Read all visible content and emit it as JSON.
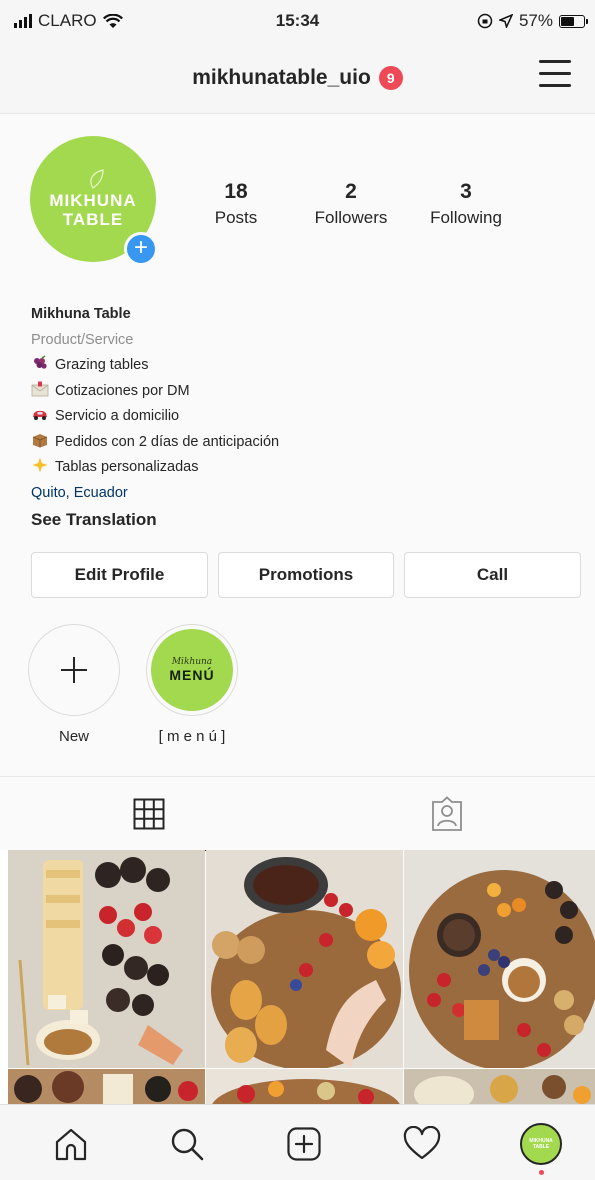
{
  "status_bar": {
    "carrier": "CLARO",
    "time": "15:34",
    "battery": "57%"
  },
  "header": {
    "username": "mikhunatable_uio",
    "notification_count": "9"
  },
  "profile": {
    "avatar_text_line1": "MIKHUNA",
    "avatar_text_line2": "TABLE",
    "stats": [
      {
        "value": "18",
        "label": "Posts"
      },
      {
        "value": "2",
        "label": "Followers"
      },
      {
        "value": "3",
        "label": "Following"
      }
    ],
    "name": "Mikhuna Table",
    "category": "Product/Service",
    "bio_lines": [
      {
        "icon": "grapes-icon",
        "text": "Grazing tables"
      },
      {
        "icon": "envelope-icon",
        "text": "Cotizaciones por DM"
      },
      {
        "icon": "car-icon",
        "text": "Servicio a domicilio"
      },
      {
        "icon": "package-icon",
        "text": "Pedidos con 2 días de anticipación"
      },
      {
        "icon": "sparkle-icon",
        "text": "Tablas personalizadas"
      }
    ],
    "location": "Quito, Ecuador",
    "see_translation": "See Translation"
  },
  "buttons": {
    "edit_profile": "Edit Profile",
    "promotions": "Promotions",
    "call": "Call"
  },
  "highlights": [
    {
      "label": "New",
      "icon": "plus-icon"
    },
    {
      "label": "[ m e n ú ]",
      "cover_small": "Mikhuna",
      "cover_big": "MENÚ"
    }
  ],
  "tabs": [
    {
      "icon": "grid-icon",
      "active": true
    },
    {
      "icon": "tagged-person-icon",
      "active": false
    }
  ],
  "nav": {
    "items": [
      "home-icon",
      "search-icon",
      "new-post-icon",
      "heart-icon",
      "profile-avatar"
    ],
    "avatar_text": "MIKHUNA TABLE"
  },
  "colors": {
    "brand_green": "#a3d94f",
    "badge_red": "#ed4956",
    "link_blue": "#003569",
    "plus_blue": "#3897f0"
  }
}
